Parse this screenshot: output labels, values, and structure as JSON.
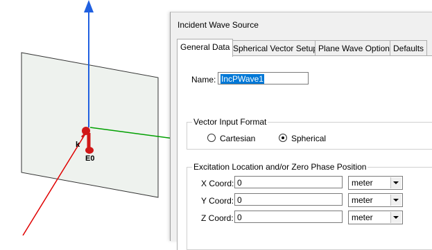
{
  "viewport": {
    "axis_labels": {
      "k": "k",
      "e0": "E0"
    }
  },
  "dialog": {
    "title": "Incident Wave Source",
    "tabs": [
      {
        "label": "General Data",
        "active": true
      },
      {
        "label": "Spherical Vector Setup",
        "active": false
      },
      {
        "label": "Plane Wave Options",
        "active": false
      },
      {
        "label": "Defaults",
        "active": false
      }
    ],
    "name_label": "Name:",
    "name_value": "IncPWave1",
    "vector_format": {
      "group_label": "Vector Input Format",
      "options": [
        "Cartesian",
        "Spherical"
      ],
      "selected": "Spherical"
    },
    "excitation": {
      "group_label": "Excitation Location and/or Zero Phase Position",
      "rows": [
        {
          "label": "X Coord:",
          "value": "0",
          "unit": "meter"
        },
        {
          "label": "Y Coord:",
          "value": "0",
          "unit": "meter"
        },
        {
          "label": "Z Coord:",
          "value": "0",
          "unit": "meter"
        }
      ]
    }
  }
}
